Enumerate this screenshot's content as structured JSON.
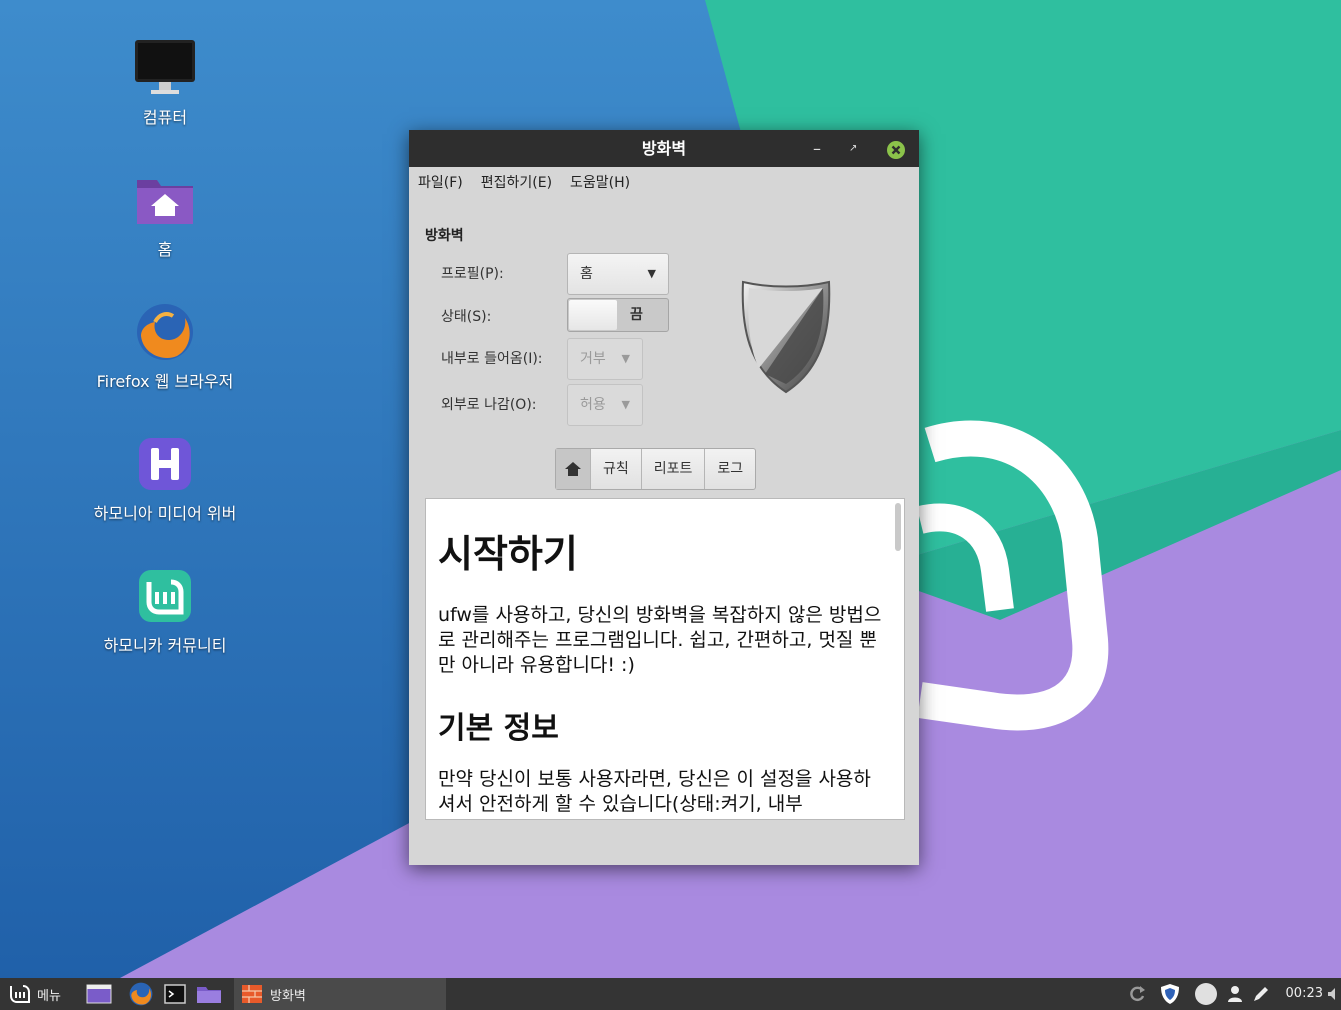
{
  "colors": {
    "wallpaper_blue": "#2f7fc3",
    "wallpaper_teal": "#2fbf9f",
    "wallpaper_purple": "#a98ae0",
    "titlebar": "#2e2e2e",
    "close_button": "#8bc34a",
    "taskbar": "#343434"
  },
  "desktop": {
    "icons": [
      {
        "label": "컴퓨터",
        "icon": "monitor-icon"
      },
      {
        "label": "홈",
        "icon": "home-folder-icon"
      },
      {
        "label": "Firefox 웹 브라우저",
        "icon": "firefox-icon"
      },
      {
        "label": "하모니아 미디어 위버",
        "icon": "harmonia-h-icon"
      },
      {
        "label": "하모니카 커뮤니티",
        "icon": "hamonikr-logo-icon"
      }
    ]
  },
  "window": {
    "title": "방화벽",
    "controls": {
      "minimize": "–",
      "maximize": "⤢",
      "close": "✕"
    },
    "menu": [
      "파일(F)",
      "편집하기(E)",
      "도움말(H)"
    ],
    "section_title": "방화벽",
    "form": {
      "profile_label": "프로필(P):",
      "profile_value": "홈",
      "status_label": "상태(S):",
      "status_value": "끔",
      "incoming_label": "내부로 들어옴(I):",
      "incoming_value": "거부",
      "outgoing_label": "외부로 나감(O):",
      "outgoing_value": "허용"
    },
    "tabs": {
      "home_icon": "home-icon",
      "rules": "규칙",
      "report": "리포트",
      "log": "로그"
    },
    "content": {
      "heading1": "시작하기",
      "para1": "ufw를 사용하고, 당신의 방화벽을 복잡하지 않은 방법으로 관리해주는 프로그램입니다. 쉽고, 간편하고, 멋질 뿐만 아니라 유용합니다! :)",
      "heading2": "기본 정보",
      "para2": "만약 당신이 보통 사용자라면, 당신은 이 설정을 사용하셔서 안전하게 할 수 있습니다(상태:켜기, 내부"
    }
  },
  "taskbar": {
    "menu_label": "메뉴",
    "window_button": "방화벽",
    "clock": "00:23"
  }
}
